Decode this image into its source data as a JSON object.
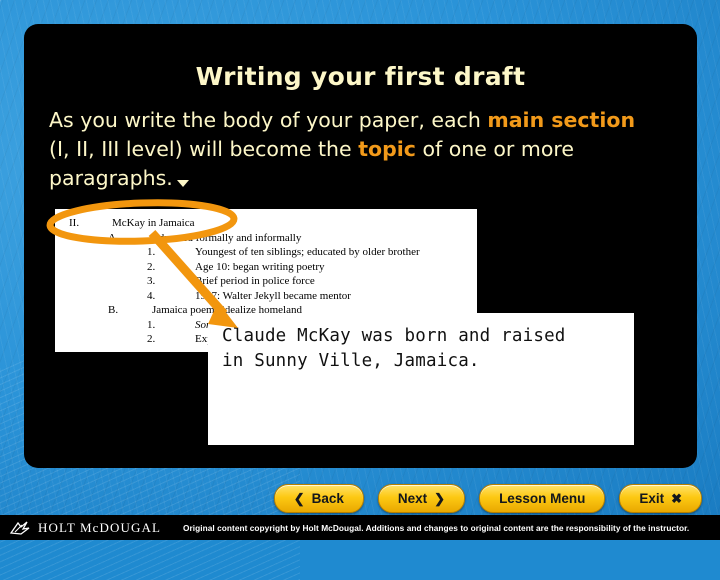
{
  "slide": {
    "title": "Writing your first draft",
    "body": {
      "seg1": "As you write the body of your paper, each ",
      "hl1": "main section",
      "seg2": "(I, II, III level) will become the ",
      "hl2": "topic",
      "seg3": " of one or more paragraphs.",
      "marker_icon": "triangle-down-icon"
    }
  },
  "outline_image": {
    "name": "outline-screenshot",
    "lines": [
      {
        "num": "II.",
        "text": "McKay in Jamaica",
        "indent": 0
      },
      {
        "num": "A.",
        "text": "Educated formally and informally",
        "indent": 1
      },
      {
        "num": "1.",
        "text": "Youngest of ten siblings; educated by older brother",
        "indent": 2
      },
      {
        "num": "2.",
        "text": "Age 10: began writing poetry",
        "indent": 2
      },
      {
        "num": "3.",
        "text": "Brief period in police force",
        "indent": 2
      },
      {
        "num": "4.",
        "text": "1907: Walter Jekyll became mentor",
        "indent": 2
      },
      {
        "num": "B.",
        "text": "Jamaica poems idealize homeland",
        "indent": 1
      },
      {
        "num": "1.",
        "text": "Songs of Jamaica",
        "indent": 2,
        "italic": true
      },
      {
        "num": "2.",
        "text": "Expressed in dialect",
        "indent": 2
      }
    ]
  },
  "annotation": {
    "ellipse_name": "orange-ellipse-highlight",
    "arrow_name": "orange-arrow",
    "color": "#F2960E"
  },
  "callout": {
    "line1": "Claude McKay was born and raised",
    "line2": "in Sunny Ville, Jamaica."
  },
  "nav": {
    "back": {
      "label": "Back",
      "icon": "chevron-left-icon"
    },
    "next": {
      "label": "Next",
      "icon": "chevron-right-icon"
    },
    "lesson_menu": {
      "label": "Lesson Menu",
      "icon": ""
    },
    "exit": {
      "label": "Exit",
      "icon": "close-x-icon"
    }
  },
  "footer": {
    "logo_icon": "holt-mcdougal-bird-icon",
    "brand": "HOLT McDOUGAL",
    "copyright": "Original content copyright by Holt McDougal. Additions and changes to original content are the responsibility of the instructor."
  }
}
